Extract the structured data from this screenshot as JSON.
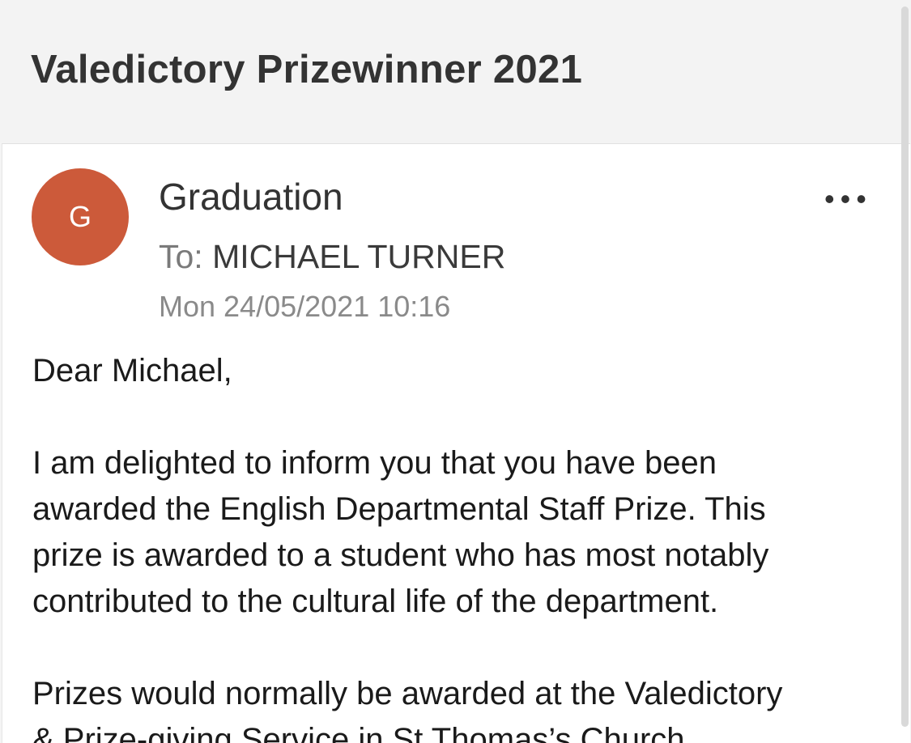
{
  "email": {
    "subject": "Valedictory Prizewinner 2021",
    "avatar_letter": "G",
    "avatar_color": "#cc5a3a",
    "sender": "Graduation",
    "more_label": "•••",
    "to_label": "To:",
    "recipient": "MICHAEL TURNER",
    "timestamp": "Mon 24/05/2021 10:16",
    "body": {
      "greeting": "Dear Michael,",
      "paragraph1": [
        "I am delighted to inform you that you have been",
        "awarded the English Departmental Staff Prize. This",
        "prize is awarded to a student who has most notably",
        "contributed to the cultural life of the department."
      ],
      "paragraph2": [
        "Prizes would normally be awarded at the Valedictory",
        "& Prize-giving Service in St Thomas’s Church"
      ]
    }
  }
}
